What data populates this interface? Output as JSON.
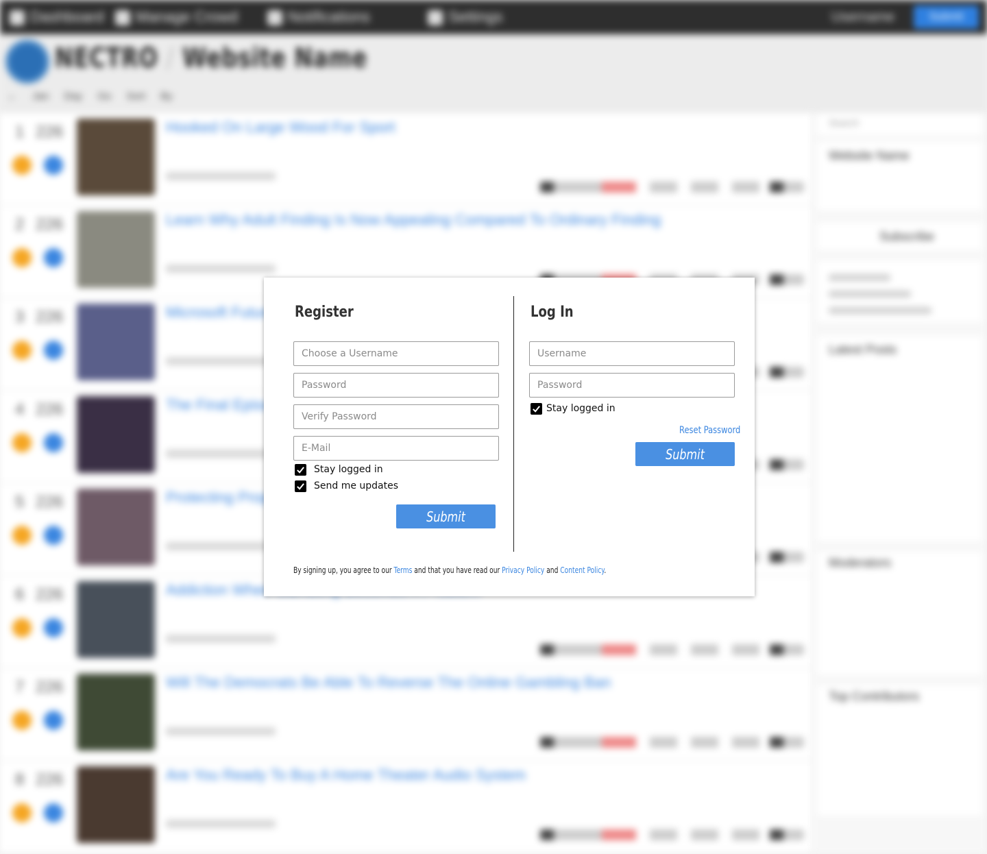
{
  "modal": {
    "register": {
      "title": "Register",
      "username_placeholder": "Choose a Username",
      "password_placeholder": "Password",
      "verify_placeholder": "Verify Password",
      "email_placeholder": "E-Mail",
      "stay_logged_in": "Stay logged in",
      "stay_logged_in_checked": true,
      "send_updates": "Send me updates",
      "send_updates_checked": true,
      "submit": "Submit"
    },
    "login": {
      "title": "Log In",
      "username_placeholder": "Username",
      "password_placeholder": "Password",
      "stay_logged_in": "Stay logged in",
      "stay_logged_in_checked": true,
      "reset_password": "Reset Password",
      "submit": "Submit"
    },
    "terms": {
      "prefix": "By signing up, you agree to our ",
      "terms_link": "Terms",
      "middle": " and that you have read our ",
      "privacy_link": "Privacy Policy",
      "and": " and ",
      "content_link": "Content Policy",
      "suffix": "."
    }
  },
  "background": {
    "nav": [
      "Dashboard",
      "Manage Crowd",
      "Notifications",
      "Settings"
    ],
    "nav_user": "Username",
    "nav_button": "Submit",
    "site_title": "NECTRO",
    "site_separator": "/",
    "site_name": "Website Name",
    "subnav": "← Jan Day Go Sort By",
    "posts": [
      {
        "rank": "1",
        "score": "226",
        "title": "Hooked On Large Wood For Sport"
      },
      {
        "rank": "2",
        "score": "226",
        "title": "Learn Why Adult Finding Is Now Appealing Compared To Ordinary Finding"
      },
      {
        "rank": "3",
        "score": "226",
        "title": "Microsoft Future Keyboard"
      },
      {
        "rank": "4",
        "score": "226",
        "title": "The Final Episode"
      },
      {
        "rank": "5",
        "score": "226",
        "title": "Protecting Property"
      },
      {
        "rank": "6",
        "score": "226",
        "title": "Addiction When Gambling Becomes A Problem"
      },
      {
        "rank": "7",
        "score": "226",
        "title": "Will The Democrats Be Able To Reverse The Online Gambling Ban"
      },
      {
        "rank": "8",
        "score": "226",
        "title": "Are You Ready To Buy A Home Theater Audio System"
      }
    ],
    "sidebar": {
      "search_placeholder": "Search",
      "site_block_title": "Website Name",
      "subscribe": "Subscribe",
      "latest_posts": "Latest Posts",
      "moderators": "Moderators",
      "top_contributors": "Top Contributors"
    }
  }
}
